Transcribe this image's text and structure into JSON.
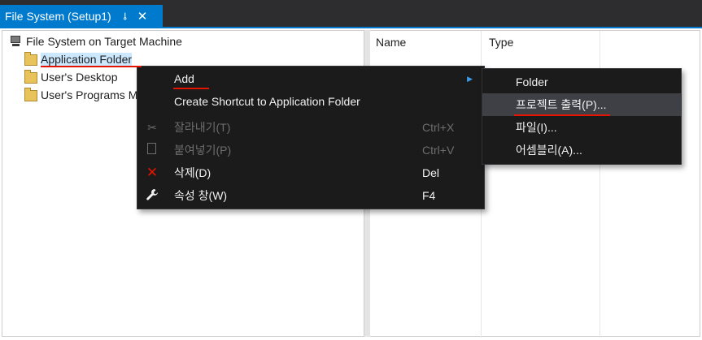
{
  "tab": {
    "title": "File System (Setup1)",
    "pin_glyph": "⊸",
    "close_glyph": "✕"
  },
  "tree": {
    "root": "File System on Target Machine",
    "items": [
      {
        "label": "Application Folder"
      },
      {
        "label": "User's Desktop"
      },
      {
        "label": "User's Programs M"
      }
    ]
  },
  "list": {
    "columns": [
      "Name",
      "Type"
    ]
  },
  "context_menu": {
    "items": [
      {
        "label": "Add",
        "has_submenu": true,
        "arrow": "▶"
      },
      {
        "label": "Create Shortcut to Application Folder"
      },
      {
        "label": "잘라내기(T)",
        "shortcut": "Ctrl+X",
        "icon": "✂",
        "disabled": true
      },
      {
        "label": "붙여넣기(P)",
        "shortcut": "Ctrl+V",
        "icon": "📋",
        "disabled": true
      },
      {
        "label": "삭제(D)",
        "shortcut": "Del",
        "icon": "✕",
        "icon_color": "#e51400"
      },
      {
        "label": "속성 창(W)",
        "shortcut": "F4",
        "icon": "🔧"
      }
    ]
  },
  "submenu": {
    "items": [
      {
        "label": "Folder"
      },
      {
        "label": "프로젝트 출력(P)..."
      },
      {
        "label": "파일(I)..."
      },
      {
        "label": "어셈블리(A)..."
      }
    ]
  },
  "colors": {
    "accent": "#007acc",
    "menu_bg": "#1b1b1c",
    "highlight": "#3f3f46",
    "annotation_red": "#e51400"
  }
}
